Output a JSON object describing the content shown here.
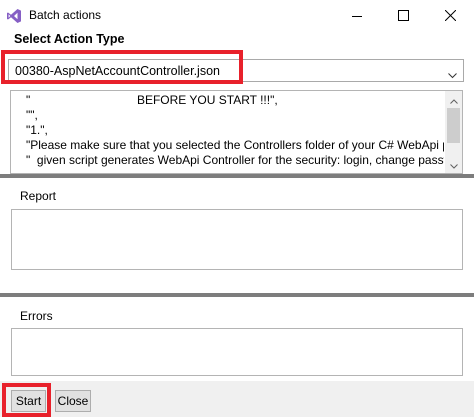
{
  "window": {
    "title": "Batch actions",
    "minimize_icon": "minimize-icon",
    "maximize_icon": "maximize-icon",
    "close_icon": "close-icon",
    "app_icon": "visual-studio-icon"
  },
  "action_type": {
    "label": "Select Action Type",
    "selected": "00380-AspNetAccountController.json"
  },
  "info": {
    "lines": [
      "\"                                BEFORE YOU START !!!\",",
      "\"\",",
      "\"1.\",",
      "\"Please make sure that you selected the Controllers folder of your C# WebApi p",
      "\"  given script generates WebApi Controller for the security: login, change passw"
    ]
  },
  "report": {
    "label": "Report"
  },
  "errors": {
    "label": "Errors"
  },
  "buttons": {
    "start": "Start",
    "close": "Close"
  },
  "colors": {
    "highlight": "#e8212b",
    "splitter": "#7d7d7d",
    "bar": "#f0f0f0"
  }
}
